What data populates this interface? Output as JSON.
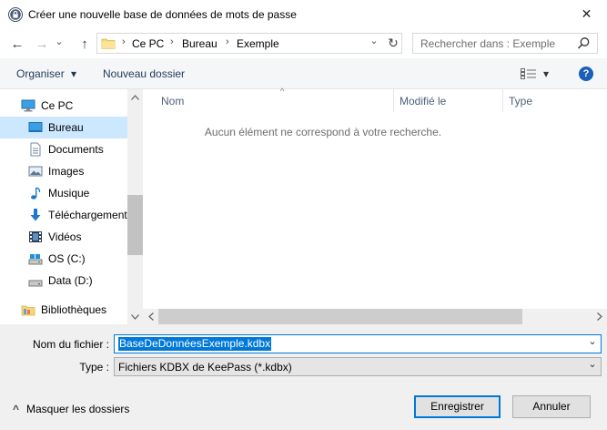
{
  "window": {
    "title": "Créer une nouvelle base de données de mots de passe",
    "close_glyph": "✕"
  },
  "nav": {
    "back_glyph": "←",
    "forward_glyph": "→",
    "recent_glyph": "⌄",
    "up_glyph": "↑"
  },
  "address": {
    "segments": [
      "Ce PC",
      "Bureau",
      "Exemple"
    ],
    "chevron": "›",
    "dropdown_glyph": "⌄",
    "refresh_glyph": "↻"
  },
  "search": {
    "placeholder": "Rechercher dans : Exemple"
  },
  "toolbar": {
    "organize_label": "Organiser",
    "organize_caret": "▾",
    "new_folder_label": "Nouveau dossier",
    "view_caret": "▾",
    "help_label": "?"
  },
  "sidebar": {
    "items": [
      {
        "label": "Ce PC",
        "icon": "computer-icon"
      },
      {
        "label": "Bureau",
        "icon": "desktop-icon",
        "selected": true
      },
      {
        "label": "Documents",
        "icon": "documents-icon"
      },
      {
        "label": "Images",
        "icon": "pictures-icon"
      },
      {
        "label": "Musique",
        "icon": "music-icon"
      },
      {
        "label": "Téléchargement",
        "icon": "downloads-icon"
      },
      {
        "label": "Vidéos",
        "icon": "videos-icon"
      },
      {
        "label": "OS (C:)",
        "icon": "drive-icon"
      },
      {
        "label": "Data (D:)",
        "icon": "drive-icon"
      },
      {
        "label": "Bibliothèques",
        "icon": "libraries-icon"
      }
    ]
  },
  "content": {
    "columns": [
      "Nom",
      "Modifié le",
      "Type"
    ],
    "sort_indicator": "^",
    "empty_message": "Aucun élément ne correspond à votre recherche."
  },
  "form": {
    "filename_label": "Nom du fichier :",
    "filename_value": "BaseDeDonnéesExemple.kdbx",
    "type_label": "Type :",
    "type_value": "Fichiers KDBX de KeePass (*.kdbx)",
    "combo_glyph": "⌄"
  },
  "footer": {
    "hide_folders_label": "Masquer les dossiers",
    "hide_folders_glyph": "^",
    "save_label": "Enregistrer",
    "cancel_label": "Annuler"
  },
  "colors": {
    "accent": "#0078d7",
    "selected_bg": "#cce8ff",
    "toolbar_bg": "#f5f6f7",
    "bottom_bg": "#f0f0f0"
  }
}
